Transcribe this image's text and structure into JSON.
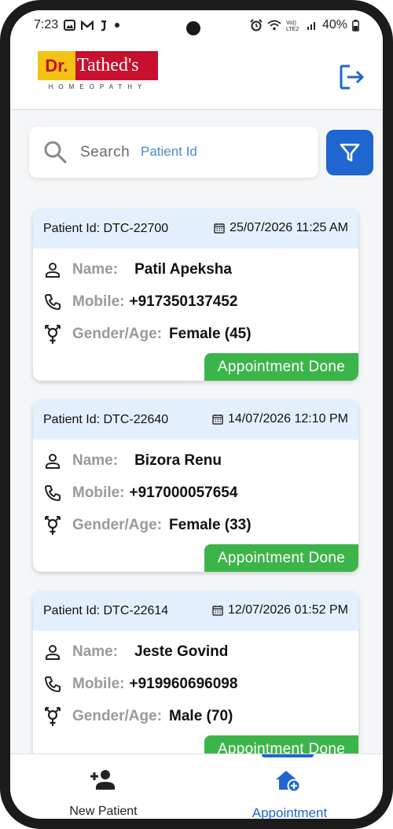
{
  "statusbar": {
    "time": "7:23",
    "left_icons": [
      "gallery-icon",
      "gmail-icon",
      "j-icon",
      "dot-icon"
    ],
    "right_icons": [
      "alarm-icon",
      "wifi-icon",
      "volte-icon",
      "signal-icon"
    ],
    "battery": "40%"
  },
  "header": {
    "logo_dr": "Dr.",
    "logo_name": "Tathed's",
    "logo_sub": "HOMEOPATHY",
    "brand_red": "#c8102e",
    "brand_yellow": "#f2c314"
  },
  "search": {
    "label": "Search",
    "placeholder": "Patient Id",
    "value": ""
  },
  "labels": {
    "name": "Name:",
    "mobile": "Mobile:",
    "gender_age": "Gender/Age:"
  },
  "patients": [
    {
      "patient_id": "Patient Id: DTC-22700",
      "datetime": "25/07/2026 11:25 AM",
      "name": "Patil Apeksha",
      "mobile": "+917350137452",
      "gender_age": "Female (45)",
      "status": "Appointment Done"
    },
    {
      "patient_id": "Patient Id: DTC-22640",
      "datetime": "14/07/2026 12:10 PM",
      "name": "Bizora Renu",
      "mobile": "+917000057654",
      "gender_age": "Female (33)",
      "status": "Appointment Done"
    },
    {
      "patient_id": "Patient Id: DTC-22614",
      "datetime": "12/07/2026 01:52 PM",
      "name": "Jeste Govind",
      "mobile": "+919960696098",
      "gender_age": "Male (70)",
      "status": "Appointment Done"
    }
  ],
  "nav": {
    "new_patient": "New Patient",
    "appointment": "Appointment",
    "active": "appointment"
  },
  "colors": {
    "accent": "#1f66d1",
    "status_done": "#3bb54a",
    "card_header": "#e3effc"
  }
}
